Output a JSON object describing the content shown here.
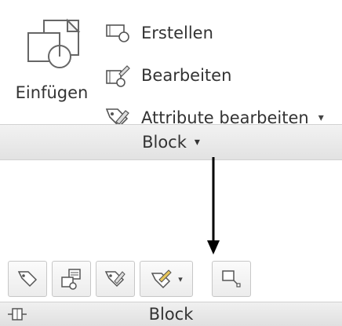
{
  "block_panel": {
    "insert_label": "Einfügen",
    "commands": [
      {
        "label": "Erstellen",
        "icon": "create-block-icon"
      },
      {
        "label": "Bearbeiten",
        "icon": "block-editor-icon"
      },
      {
        "label": "Attribute bearbeiten",
        "icon": "edit-attributes-icon",
        "has_dropdown": true
      }
    ],
    "title": "Block",
    "title_arrow": "▾"
  },
  "compact_panel": {
    "title": "Block",
    "dropdown_arrow": "▾",
    "tools": [
      {
        "icon": "tag-icon"
      },
      {
        "icon": "block-editor-icon"
      },
      {
        "icon": "edit-attributes-icon"
      },
      {
        "icon": "attribute-manager-icon",
        "has_dropdown": true
      },
      {
        "icon": "selection-icon"
      }
    ]
  },
  "colors": {
    "panel_bar": "#e6e6e6",
    "text": "#333333",
    "border": "#c7c7c7"
  }
}
